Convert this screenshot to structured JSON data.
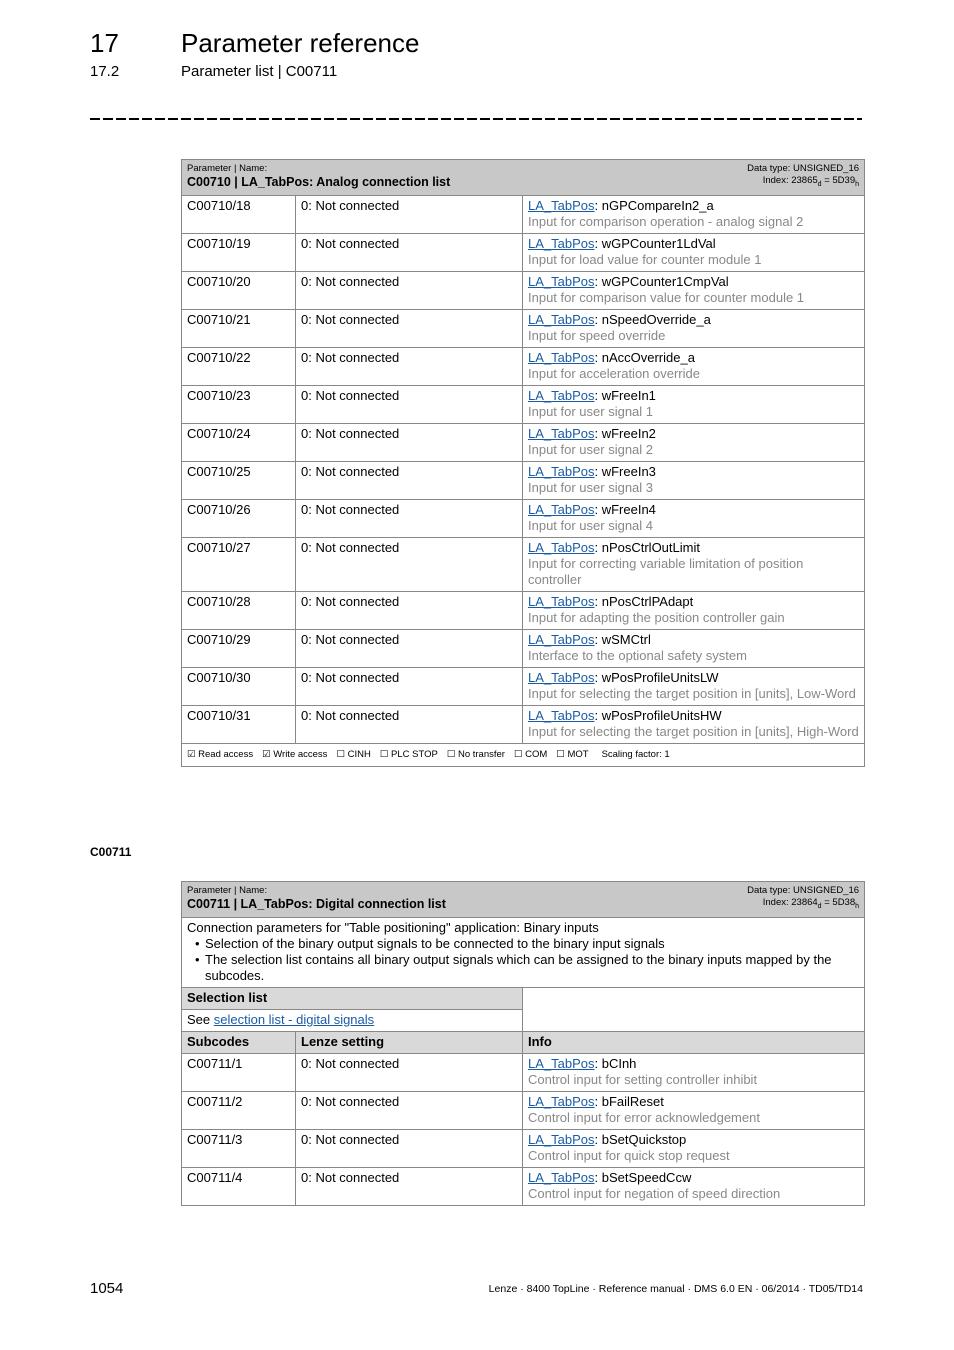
{
  "header": {
    "chapter_number": "17",
    "chapter_title": "Parameter reference",
    "section_number": "17.2",
    "section_title": "Parameter list | C00711"
  },
  "table_c00710": {
    "header_label": "Parameter | Name:",
    "name": "C00710 | LA_TabPos: Analog connection list",
    "data_type": "Data type: UNSIGNED_16",
    "index_prefix": "Index: 23865",
    "index_sub_d": "d",
    "index_eq": " = 5D39",
    "index_sub_h": "h",
    "rows": [
      {
        "code": "C00710/18",
        "setting": "0: Not connected",
        "link": "LA_TabPos",
        "signal": ": nGPCompareIn2_a",
        "desc": "Input for comparison operation - analog signal 2"
      },
      {
        "code": "C00710/19",
        "setting": "0: Not connected",
        "link": "LA_TabPos",
        "signal": ": wGPCounter1LdVal",
        "desc": "Input for load value for counter module 1"
      },
      {
        "code": "C00710/20",
        "setting": "0: Not connected",
        "link": "LA_TabPos",
        "signal": ": wGPCounter1CmpVal",
        "desc": "Input for comparison value for counter module 1"
      },
      {
        "code": "C00710/21",
        "setting": "0: Not connected",
        "link": "LA_TabPos",
        "signal": ": nSpeedOverride_a",
        "desc": "Input for speed override"
      },
      {
        "code": "C00710/22",
        "setting": "0: Not connected",
        "link": "LA_TabPos",
        "signal": ": nAccOverride_a",
        "desc": "Input for acceleration override"
      },
      {
        "code": "C00710/23",
        "setting": "0: Not connected",
        "link": "LA_TabPos",
        "signal": ": wFreeIn1",
        "desc": "Input for user signal 1"
      },
      {
        "code": "C00710/24",
        "setting": "0: Not connected",
        "link": "LA_TabPos",
        "signal": ": wFreeIn2",
        "desc": "Input for user signal 2"
      },
      {
        "code": "C00710/25",
        "setting": "0: Not connected",
        "link": "LA_TabPos",
        "signal": ": wFreeIn3",
        "desc": "Input for user signal 3"
      },
      {
        "code": "C00710/26",
        "setting": "0: Not connected",
        "link": "LA_TabPos",
        "signal": ": wFreeIn4",
        "desc": "Input for user signal 4"
      },
      {
        "code": "C00710/27",
        "setting": "0: Not connected",
        "link": "LA_TabPos",
        "signal": ": nPosCtrlOutLimit",
        "desc": "Input for correcting variable limitation of position controller"
      },
      {
        "code": "C00710/28",
        "setting": "0: Not connected",
        "link": "LA_TabPos",
        "signal": ": nPosCtrlPAdapt",
        "desc": "Input for adapting the position controller gain"
      },
      {
        "code": "C00710/29",
        "setting": "0: Not connected",
        "link": "LA_TabPos",
        "signal": ": wSMCtrl",
        "desc": "Interface to the optional safety system"
      },
      {
        "code": "C00710/30",
        "setting": "0: Not connected",
        "link": "LA_TabPos",
        "signal": ": wPosProfileUnitsLW",
        "desc": "Input for selecting the target position in [units], Low-Word"
      },
      {
        "code": "C00710/31",
        "setting": "0: Not connected",
        "link": "LA_TabPos",
        "signal": ": wPosProfileUnitsHW",
        "desc": "Input for selecting the target position in [units], High-Word"
      }
    ],
    "footer": {
      "read_access": "☑ Read access",
      "write_access": "☑ Write access",
      "cinh": "☐ CINH",
      "plc_stop": "☐ PLC STOP",
      "no_transfer": "☐ No transfer",
      "com": "☐ COM",
      "mot": "☐ MOT",
      "scaling": "Scaling factor: 1"
    }
  },
  "section_label": "C00711",
  "table_c00711": {
    "header_label": "Parameter | Name:",
    "name": "C00711 | LA_TabPos: Digital connection list",
    "data_type": "Data type: UNSIGNED_16",
    "index_prefix": "Index: 23864",
    "index_sub_d": "d",
    "index_eq": " = 5D38",
    "index_sub_h": "h",
    "intro": "Connection parameters for \"Table positioning\" application: Binary inputs",
    "bullets": [
      "Selection of the binary output signals to be connected to the binary input signals",
      "The selection list contains all binary output signals which can be assigned to the binary inputs mapped by the subcodes."
    ],
    "selection_list_heading": "Selection list",
    "selection_see": "See ",
    "selection_link": "selection list - digital signals",
    "col_subcodes": "Subcodes",
    "col_lenze": "Lenze setting",
    "col_info": "Info",
    "rows": [
      {
        "code": "C00711/1",
        "setting": "0: Not connected",
        "link": "LA_TabPos",
        "signal": ": bCInh",
        "desc": "Control input for setting controller inhibit"
      },
      {
        "code": "C00711/2",
        "setting": "0: Not connected",
        "link": "LA_TabPos",
        "signal": ": bFailReset",
        "desc": "Control input for error acknowledgement"
      },
      {
        "code": "C00711/3",
        "setting": "0: Not connected",
        "link": "LA_TabPos",
        "signal": ": bSetQuickstop",
        "desc": "Control input for quick stop request"
      },
      {
        "code": "C00711/4",
        "setting": "0: Not connected",
        "link": "LA_TabPos",
        "signal": ": bSetSpeedCcw",
        "desc": "Control input for negation of speed direction"
      }
    ]
  },
  "footer": {
    "page_number": "1054",
    "doc_info": "Lenze · 8400 TopLine · Reference manual · DMS 6.0 EN · 06/2014 · TD05/TD14"
  }
}
